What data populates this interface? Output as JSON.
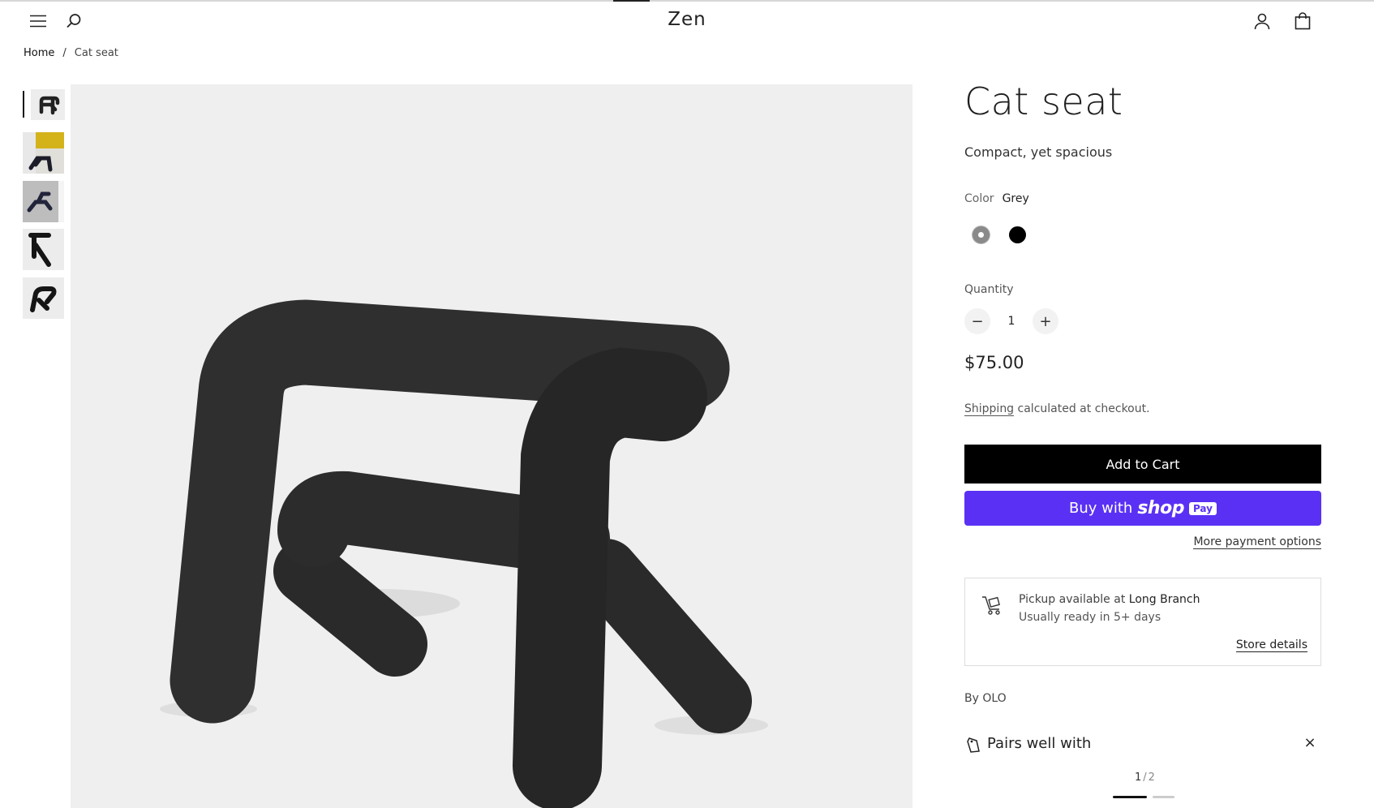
{
  "header": {
    "logo": "Zen",
    "icons": [
      "menu-icon",
      "search-icon",
      "account-icon",
      "cart-icon"
    ]
  },
  "breadcrumb": {
    "home": "Home",
    "separator": "/",
    "current": "Cat seat"
  },
  "product": {
    "title": "Cat seat",
    "subtitle": "Compact, yet spacious",
    "color_label": "Color",
    "color_value": "Grey",
    "colors": [
      {
        "name": "Grey",
        "hex": "#8a8a8a",
        "selected": true
      },
      {
        "name": "Black",
        "hex": "#000000",
        "selected": false
      }
    ],
    "quantity_label": "Quantity",
    "quantity": "1",
    "minus": "−",
    "plus": "+",
    "price": "$75.00",
    "shipping_link": "Shipping",
    "shipping_text": " calculated at checkout.",
    "add_to_cart": "Add to Cart",
    "buy_with": "Buy with",
    "shop_brand": "shop",
    "shop_pay": "Pay",
    "more_payment": "More payment options",
    "vendor": "By OLO"
  },
  "pickup": {
    "line1_prefix": "Pickup available at ",
    "location": "Long Branch",
    "line2": "Usually ready in 5+ days",
    "store_details": "Store details"
  },
  "pairs": {
    "title": "Pairs well with",
    "close": "×",
    "page_current": "1",
    "page_sep": "/",
    "page_total": "2"
  },
  "gallery": {
    "thumbnail_count": 5,
    "active_index": 0
  },
  "colors": {
    "shop_pay": "#5a31f4",
    "cart_button": "#000000",
    "image_bg": "#efefef"
  }
}
